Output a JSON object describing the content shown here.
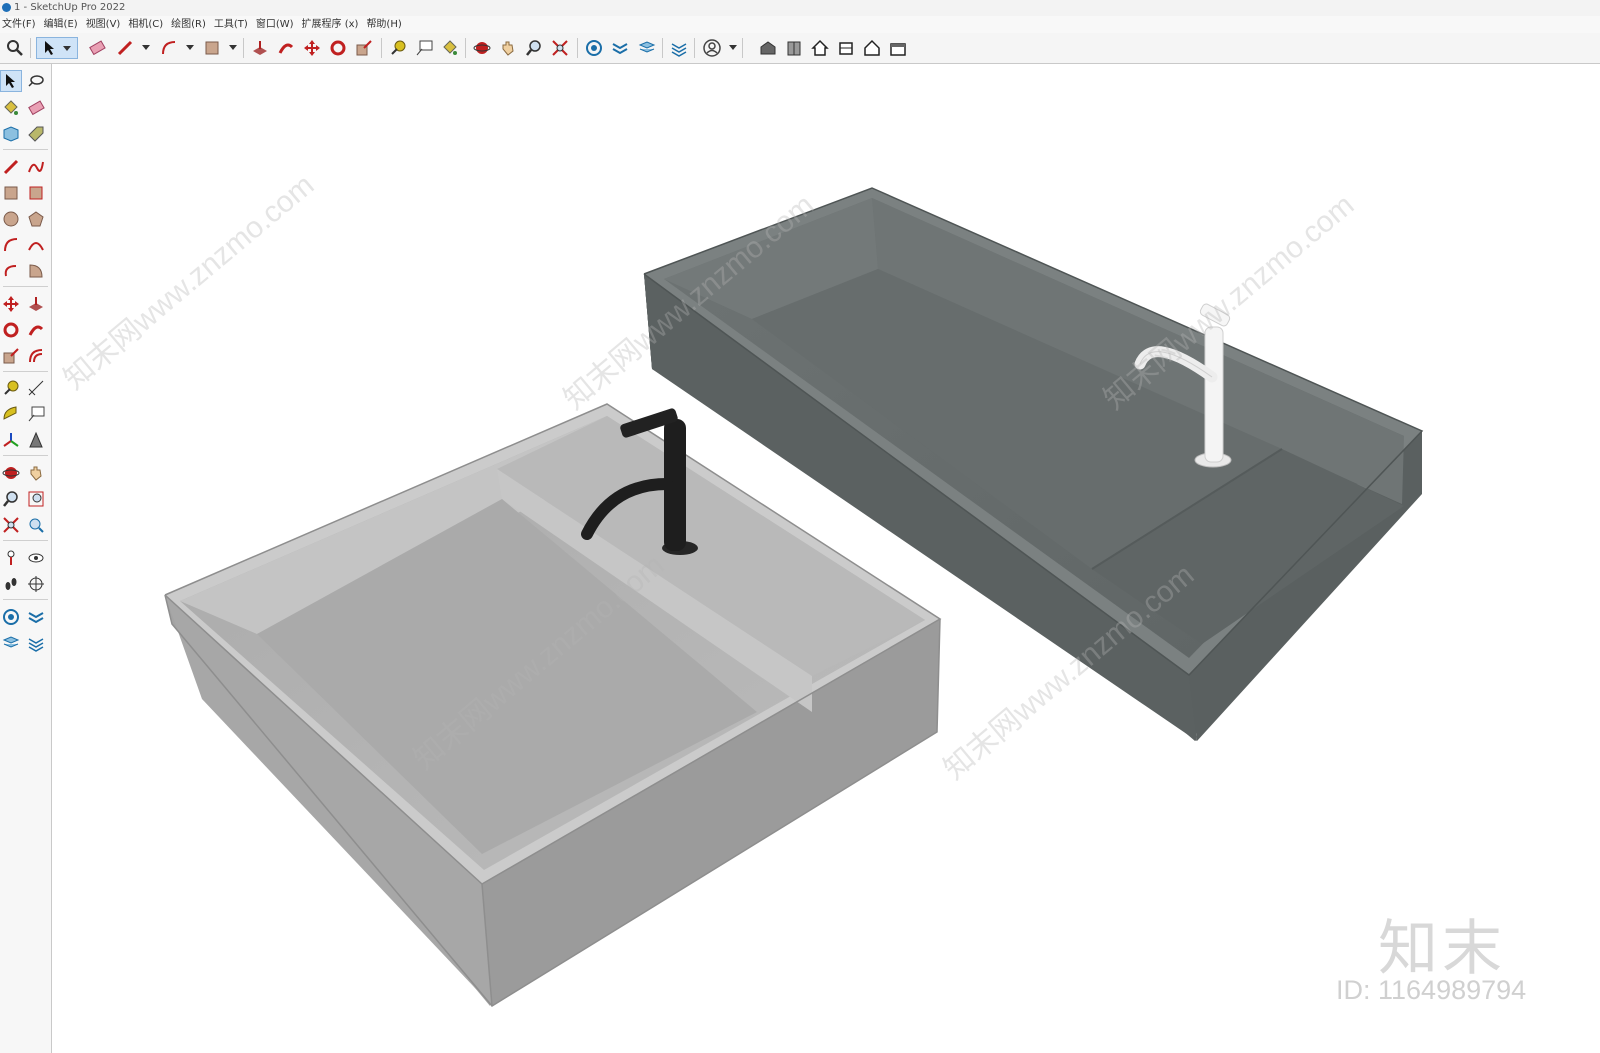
{
  "window": {
    "title": "1 - SketchUp Pro 2022"
  },
  "menu": [
    {
      "label": "文件(F)"
    },
    {
      "label": "编辑(E)"
    },
    {
      "label": "视图(V)"
    },
    {
      "label": "相机(C)"
    },
    {
      "label": "绘图(R)"
    },
    {
      "label": "工具(T)"
    },
    {
      "label": "窗口(W)"
    },
    {
      "label": "扩展程序 (x)"
    },
    {
      "label": "帮助(H)"
    }
  ],
  "toolbar_icons": [
    "zoom-icon",
    "select-icon",
    "eraser-icon",
    "pencil-icon",
    "arc-icon",
    "rectangle-icon",
    "push-pull-icon",
    "follow-me-icon",
    "move-icon",
    "rotate-icon",
    "scale-icon",
    "tape-measure-icon",
    "text-icon",
    "paint-bucket-icon",
    "orbit-icon",
    "pan-icon",
    "zoom-tool-icon",
    "zoom-extents-icon",
    "outliner-icon",
    "sandbox-icon",
    "layers-icon",
    "tags-icon",
    "account-icon",
    "warehouse-icon",
    "extension-icon",
    "home-icon",
    "components-icon",
    "house-outline-icon",
    "building-icon"
  ],
  "watermark": {
    "brand": "知末",
    "id_text": "ID: 1164989794",
    "site_text": "知末网www.znzmo.com"
  },
  "colors": {
    "light_basin": "#b5b5b5",
    "dark_basin": "#646a6a",
    "black_faucet": "#1e1e1e",
    "white_faucet": "#f2f2f2",
    "accent_active": "#cfe3f7"
  }
}
